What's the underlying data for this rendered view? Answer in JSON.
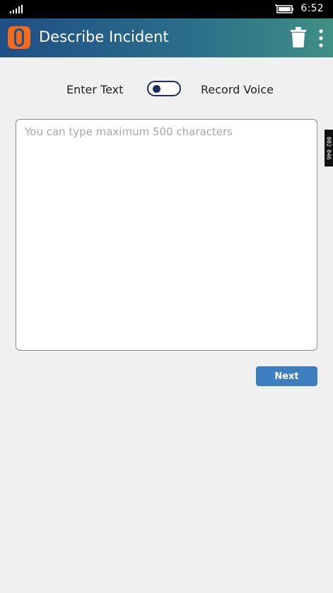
{
  "status": {
    "time": "6:52",
    "signal_icon": "signal-bars-icon",
    "battery_icon": "battery-charging-icon"
  },
  "appbar": {
    "title": "Describe Incident",
    "logo_icon": "app-logo-icon",
    "delete_icon": "trash-icon",
    "more_icon": "more-vertical-icon",
    "gradient_start": "#1f4f86",
    "gradient_end": "#3f8f86"
  },
  "input_mode": {
    "left_label": "Enter Text",
    "right_label": "Record Voice",
    "selected": "Enter Text"
  },
  "description": {
    "placeholder": "You can type maximum 500 characters",
    "value": ""
  },
  "actions": {
    "next_label": "Next",
    "accent": "#3d7ebf"
  },
  "side_tag": {
    "top": "002",
    "bottom": "046"
  }
}
